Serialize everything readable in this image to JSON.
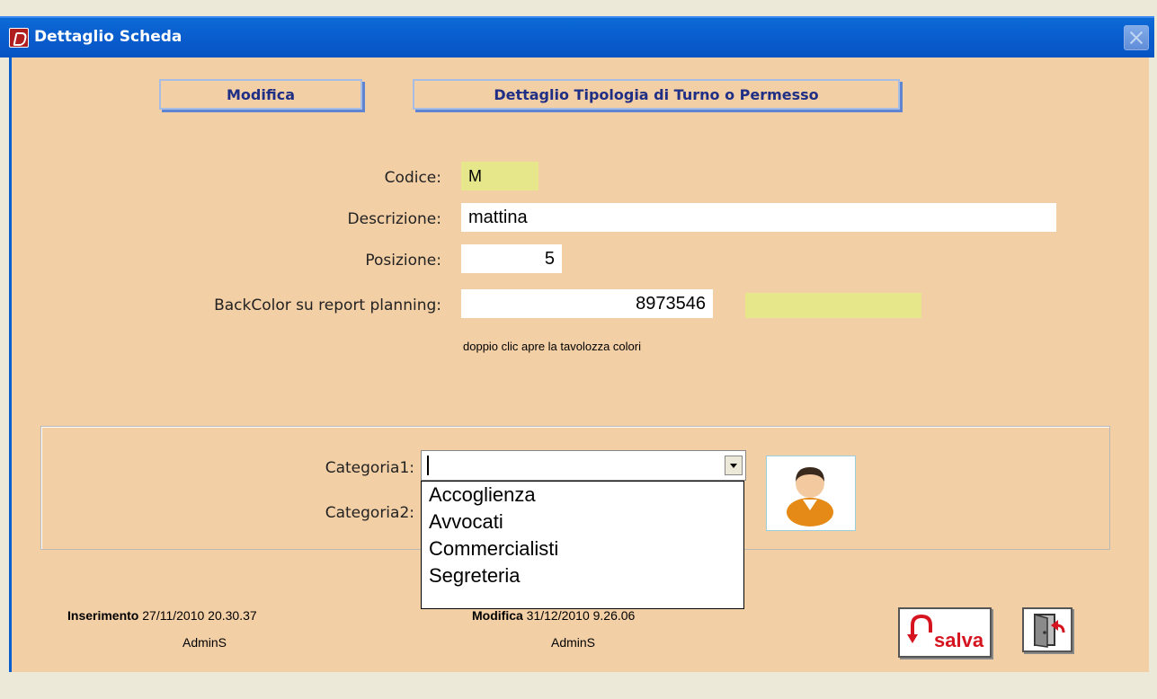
{
  "window": {
    "title": "Dettaglio Scheda"
  },
  "tabs": {
    "mode": "Modifica",
    "section": "Dettaglio Tipologia di Turno o Permesso"
  },
  "fields": {
    "codice_label": "Codice:",
    "codice_value": "M",
    "descrizione_label": "Descrizione:",
    "descrizione_value": "mattina",
    "posizione_label": "Posizione:",
    "posizione_value": "5",
    "backcolor_label": "BackColor su report planning:",
    "backcolor_value": "8973546",
    "backcolor_swatch": "#e6e68a",
    "backcolor_hint": "doppio clic apre la tavolozza colori"
  },
  "categories": {
    "cat1_label": "Categoria1:",
    "cat1_value": "",
    "cat2_label": "Categoria2:",
    "options": [
      "Accoglienza",
      "Avvocati",
      "Commercialisti",
      "Segreteria"
    ]
  },
  "footer": {
    "inserimento_label": "Inserimento",
    "inserimento_date": "27/11/2010 20.30.37",
    "inserimento_user": "AdminS",
    "modifica_label": "Modifica",
    "modifica_date": "31/12/2010 9.26.06",
    "modifica_user": "AdminS"
  },
  "buttons": {
    "save_label": "salva",
    "save_icon": "undo-arrow-icon",
    "exit_icon": "exit-door-icon"
  },
  "colors": {
    "form_bg": "#f3cfa6",
    "titlebar": "#0a5fcf",
    "tab_text": "#1f2f86",
    "readonly_field": "#e6e68a",
    "save_red": "#d6141f"
  }
}
